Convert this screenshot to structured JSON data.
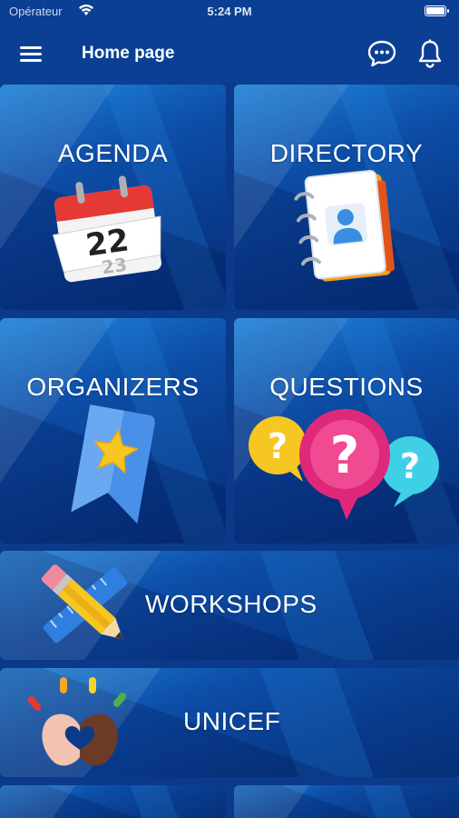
{
  "status_bar": {
    "carrier": "Opérateur",
    "time": "5:24 PM"
  },
  "nav": {
    "title": "Home page",
    "menu_icon": "hamburger-menu-icon",
    "chat_icon": "chat-bubble-icon",
    "bell_icon": "bell-icon"
  },
  "tiles": [
    {
      "label": "AGENDA",
      "icon": "calendar-icon"
    },
    {
      "label": "DIRECTORY",
      "icon": "address-book-icon"
    },
    {
      "label": "ORGANIZERS",
      "icon": "bookmark-star-icon"
    },
    {
      "label": "QUESTIONS",
      "icon": "question-bubbles-icon"
    },
    {
      "label": "WORKSHOPS",
      "icon": "pencil-ruler-icon"
    },
    {
      "label": "UNICEF",
      "icon": "heart-hands-icon"
    }
  ],
  "calendar_number": "22",
  "colors": {
    "nav_background": "#0a3f93",
    "tile_accent": "#1a7fd6",
    "calendar_red": "#e53935",
    "question_yellow": "#f6c623",
    "question_pink": "#e0287a",
    "question_cyan": "#3fd0e6"
  }
}
